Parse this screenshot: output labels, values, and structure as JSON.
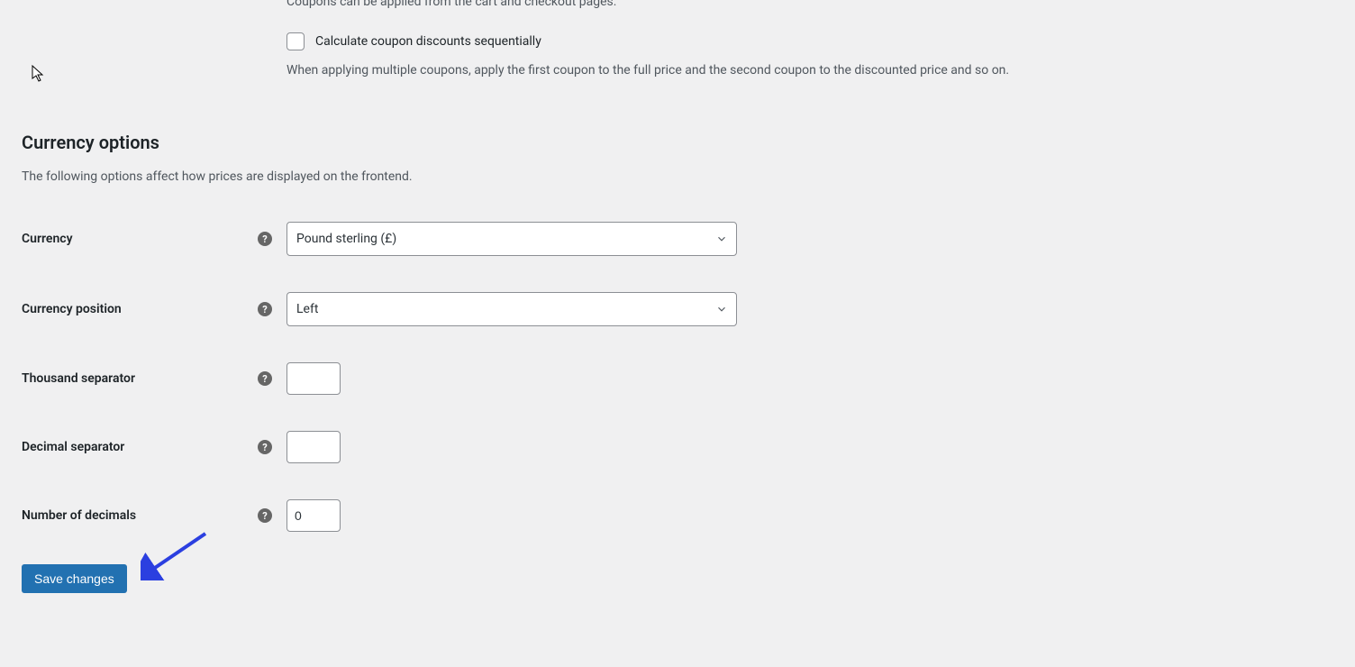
{
  "coupons": {
    "desc_truncated": "Coupons can be applied from the cart and checkout pages.",
    "sequential_label": "Calculate coupon discounts sequentially",
    "sequential_desc": "When applying multiple coupons, apply the first coupon to the full price and the second coupon to the discounted price and so on."
  },
  "currency": {
    "title": "Currency options",
    "desc": "The following options affect how prices are displayed on the frontend.",
    "fields": {
      "currency_label": "Currency",
      "currency_value": "Pound sterling (£)",
      "position_label": "Currency position",
      "position_value": "Left",
      "thousand_label": "Thousand separator",
      "thousand_value": "",
      "decimal_label": "Decimal separator",
      "decimal_value": "",
      "numdecimals_label": "Number of decimals",
      "numdecimals_value": "0"
    }
  },
  "actions": {
    "save_label": "Save changes"
  },
  "help_glyph": "?"
}
